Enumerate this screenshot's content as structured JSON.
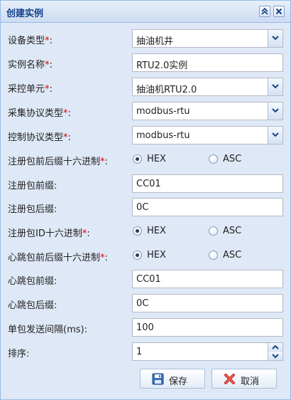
{
  "panel": {
    "title": "创建实例"
  },
  "tools": {
    "collapse": "double-up-chevron-icon",
    "close": "close-icon"
  },
  "form": {
    "device_type": {
      "label": "设备类型",
      "value": "抽油机井"
    },
    "instance_name": {
      "label": "实例名称",
      "value": "RTU2.0实例"
    },
    "control_unit": {
      "label": "采控单元",
      "value": "抽油机RTU2.0"
    },
    "acq_protocol": {
      "label": "采集协议类型",
      "value": "modbus-rtu"
    },
    "ctrl_protocol": {
      "label": "控制协议类型",
      "value": "modbus-rtu"
    },
    "reg_hex": {
      "label": "注册包前后缀十六进制",
      "opt1": "HEX",
      "opt2": "ASC",
      "selected": "HEX"
    },
    "reg_prefix": {
      "label": "注册包前缀:",
      "value": "CC01"
    },
    "reg_suffix": {
      "label": "注册包后缀:",
      "value": "0C"
    },
    "reg_id_hex": {
      "label": "注册包ID十六进制",
      "opt1": "HEX",
      "opt2": "ASC",
      "selected": "HEX"
    },
    "hb_hex": {
      "label": "心跳包前后缀十六进制",
      "opt1": "HEX",
      "opt2": "ASC",
      "selected": "HEX"
    },
    "hb_prefix": {
      "label": "心跳包前缀:",
      "value": "CC01"
    },
    "hb_suffix": {
      "label": "心跳包后缀:",
      "value": "0C"
    },
    "send_interval": {
      "label": "单包发送间隔(ms):",
      "value": "100"
    },
    "sort": {
      "label": "排序:",
      "value": "1"
    }
  },
  "required_mark": "*",
  "colon": ":",
  "buttons": {
    "save": "保存",
    "cancel": "取消"
  },
  "colors": {
    "required": "#e00000",
    "title": "#15428b",
    "border": "#99bbe8"
  }
}
